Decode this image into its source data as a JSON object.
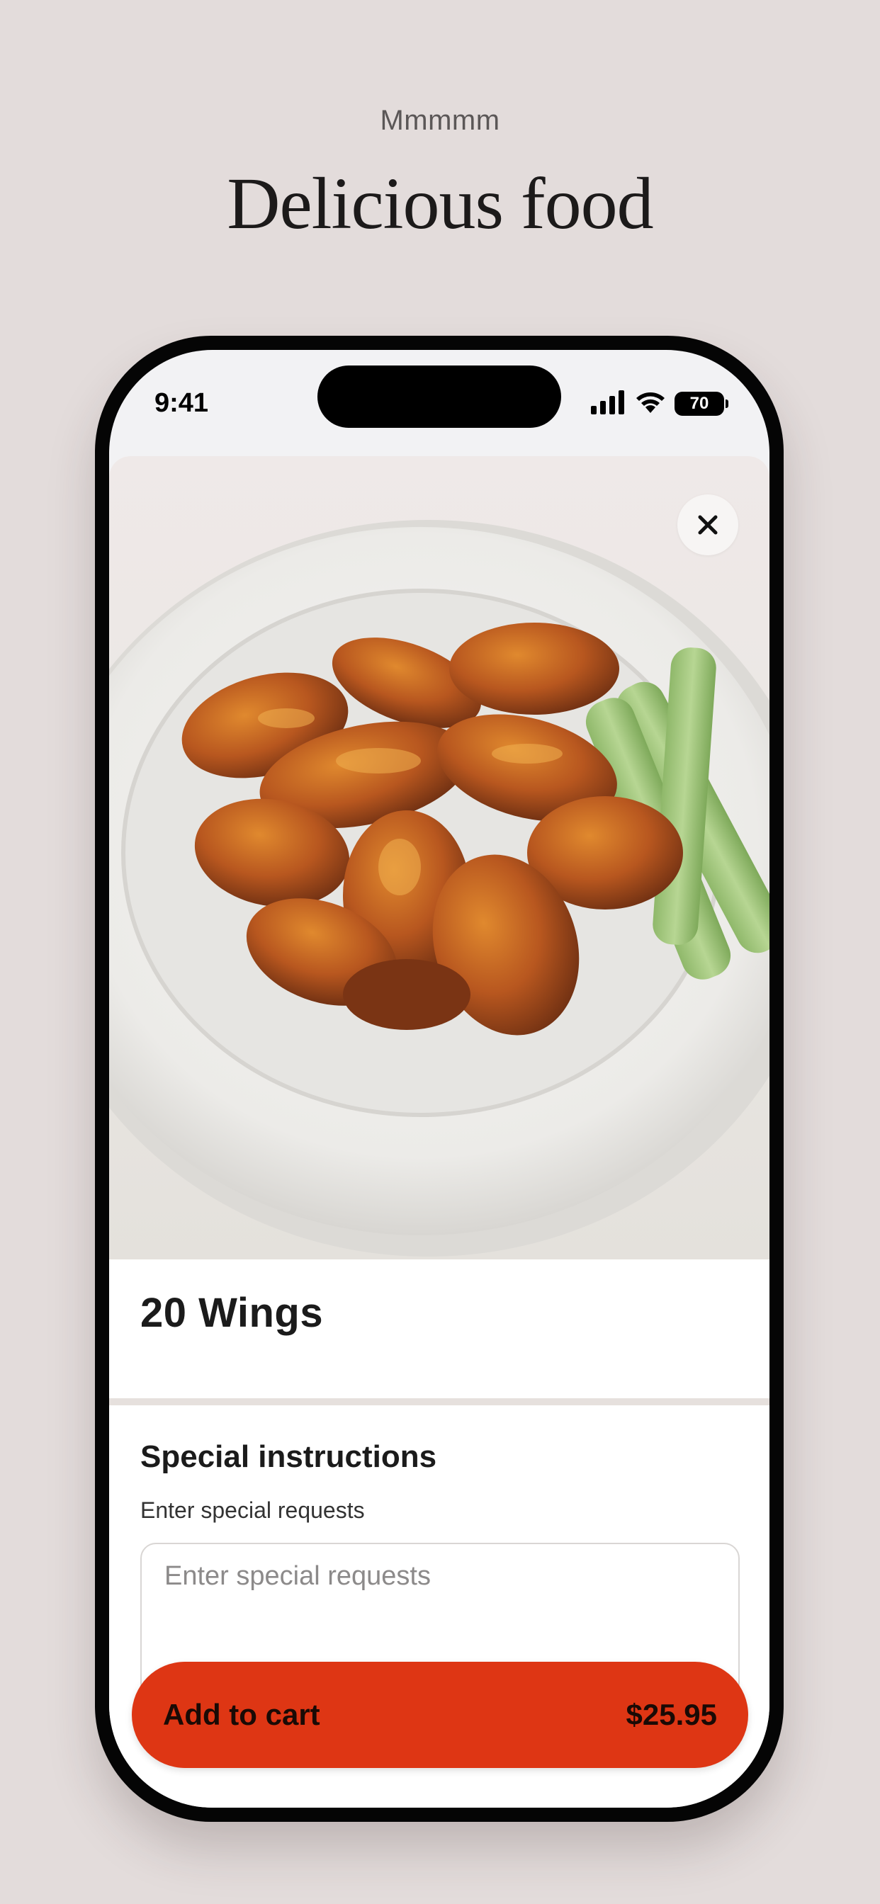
{
  "hero": {
    "kicker": "Mmmmm",
    "title": "Delicious food"
  },
  "status_bar": {
    "time": "9:41",
    "battery": "70",
    "icons": [
      "signal-icon",
      "wifi-icon",
      "battery-icon"
    ]
  },
  "item": {
    "title": "20 Wings",
    "image_description_icon": "food-photo"
  },
  "special_instructions": {
    "title": "Special instructions",
    "subtitle": "Enter special requests",
    "placeholder": "Enter special requests",
    "value": ""
  },
  "cart": {
    "label": "Add to cart",
    "price": "$25.95"
  },
  "colors": {
    "background": "#e3dcdb",
    "accent": "#de3614",
    "text": "#1b1b1b"
  }
}
